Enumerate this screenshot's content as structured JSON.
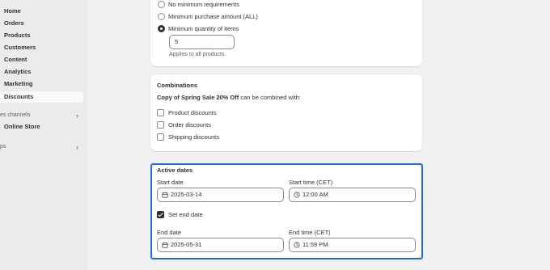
{
  "sidebar": {
    "items": [
      {
        "label": "Home"
      },
      {
        "label": "Orders"
      },
      {
        "label": "Products"
      },
      {
        "label": "Customers"
      },
      {
        "label": "Content"
      },
      {
        "label": "Analytics"
      },
      {
        "label": "Marketing"
      },
      {
        "label": "Discounts"
      }
    ],
    "sales_channels_label": "es channels",
    "online_store_label": "Online Store",
    "apps_label": "ps"
  },
  "requirements": {
    "options": [
      {
        "label": "No minimum requirements",
        "checked": false
      },
      {
        "label": "Minimum purchase amount (ALL)",
        "checked": false
      },
      {
        "label": "Minimum quantity of items",
        "checked": true
      }
    ],
    "quantity_value": "5",
    "help_text": "Applies to all products."
  },
  "combinations": {
    "title": "Combinations",
    "discount_name": "Copy of Spring Sale 20% Off",
    "suffix_text": " can be combined with:",
    "options": [
      {
        "label": "Product discounts",
        "checked": false
      },
      {
        "label": "Order discounts",
        "checked": false
      },
      {
        "label": "Shipping discounts",
        "checked": false
      }
    ]
  },
  "active_dates": {
    "title": "Active dates",
    "start_date_label": "Start date",
    "start_date_value": "2025-03-14",
    "start_time_label": "Start time (CET)",
    "start_time_value": "12:00 AM",
    "set_end_date_label": "Set end date",
    "set_end_date_checked": true,
    "end_date_label": "End date",
    "end_date_value": "2025-05-31",
    "end_time_label": "End time (CET)",
    "end_time_value": "11:59 PM"
  },
  "colors": {
    "focus_ring": "#2c6ecb",
    "sidebar_bg": "#ebebeb",
    "page_bg": "#f1f1f1"
  }
}
